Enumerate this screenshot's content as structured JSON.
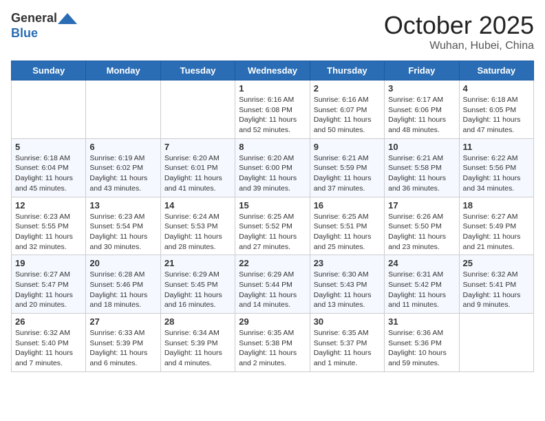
{
  "header": {
    "logo_line1": "General",
    "logo_line2": "Blue",
    "month": "October 2025",
    "location": "Wuhan, Hubei, China"
  },
  "weekdays": [
    "Sunday",
    "Monday",
    "Tuesday",
    "Wednesday",
    "Thursday",
    "Friday",
    "Saturday"
  ],
  "weeks": [
    [
      {
        "day": "",
        "info": ""
      },
      {
        "day": "",
        "info": ""
      },
      {
        "day": "",
        "info": ""
      },
      {
        "day": "1",
        "info": "Sunrise: 6:16 AM\nSunset: 6:08 PM\nDaylight: 11 hours\nand 52 minutes."
      },
      {
        "day": "2",
        "info": "Sunrise: 6:16 AM\nSunset: 6:07 PM\nDaylight: 11 hours\nand 50 minutes."
      },
      {
        "day": "3",
        "info": "Sunrise: 6:17 AM\nSunset: 6:06 PM\nDaylight: 11 hours\nand 48 minutes."
      },
      {
        "day": "4",
        "info": "Sunrise: 6:18 AM\nSunset: 6:05 PM\nDaylight: 11 hours\nand 47 minutes."
      }
    ],
    [
      {
        "day": "5",
        "info": "Sunrise: 6:18 AM\nSunset: 6:04 PM\nDaylight: 11 hours\nand 45 minutes."
      },
      {
        "day": "6",
        "info": "Sunrise: 6:19 AM\nSunset: 6:02 PM\nDaylight: 11 hours\nand 43 minutes."
      },
      {
        "day": "7",
        "info": "Sunrise: 6:20 AM\nSunset: 6:01 PM\nDaylight: 11 hours\nand 41 minutes."
      },
      {
        "day": "8",
        "info": "Sunrise: 6:20 AM\nSunset: 6:00 PM\nDaylight: 11 hours\nand 39 minutes."
      },
      {
        "day": "9",
        "info": "Sunrise: 6:21 AM\nSunset: 5:59 PM\nDaylight: 11 hours\nand 37 minutes."
      },
      {
        "day": "10",
        "info": "Sunrise: 6:21 AM\nSunset: 5:58 PM\nDaylight: 11 hours\nand 36 minutes."
      },
      {
        "day": "11",
        "info": "Sunrise: 6:22 AM\nSunset: 5:56 PM\nDaylight: 11 hours\nand 34 minutes."
      }
    ],
    [
      {
        "day": "12",
        "info": "Sunrise: 6:23 AM\nSunset: 5:55 PM\nDaylight: 11 hours\nand 32 minutes."
      },
      {
        "day": "13",
        "info": "Sunrise: 6:23 AM\nSunset: 5:54 PM\nDaylight: 11 hours\nand 30 minutes."
      },
      {
        "day": "14",
        "info": "Sunrise: 6:24 AM\nSunset: 5:53 PM\nDaylight: 11 hours\nand 28 minutes."
      },
      {
        "day": "15",
        "info": "Sunrise: 6:25 AM\nSunset: 5:52 PM\nDaylight: 11 hours\nand 27 minutes."
      },
      {
        "day": "16",
        "info": "Sunrise: 6:25 AM\nSunset: 5:51 PM\nDaylight: 11 hours\nand 25 minutes."
      },
      {
        "day": "17",
        "info": "Sunrise: 6:26 AM\nSunset: 5:50 PM\nDaylight: 11 hours\nand 23 minutes."
      },
      {
        "day": "18",
        "info": "Sunrise: 6:27 AM\nSunset: 5:49 PM\nDaylight: 11 hours\nand 21 minutes."
      }
    ],
    [
      {
        "day": "19",
        "info": "Sunrise: 6:27 AM\nSunset: 5:47 PM\nDaylight: 11 hours\nand 20 minutes."
      },
      {
        "day": "20",
        "info": "Sunrise: 6:28 AM\nSunset: 5:46 PM\nDaylight: 11 hours\nand 18 minutes."
      },
      {
        "day": "21",
        "info": "Sunrise: 6:29 AM\nSunset: 5:45 PM\nDaylight: 11 hours\nand 16 minutes."
      },
      {
        "day": "22",
        "info": "Sunrise: 6:29 AM\nSunset: 5:44 PM\nDaylight: 11 hours\nand 14 minutes."
      },
      {
        "day": "23",
        "info": "Sunrise: 6:30 AM\nSunset: 5:43 PM\nDaylight: 11 hours\nand 13 minutes."
      },
      {
        "day": "24",
        "info": "Sunrise: 6:31 AM\nSunset: 5:42 PM\nDaylight: 11 hours\nand 11 minutes."
      },
      {
        "day": "25",
        "info": "Sunrise: 6:32 AM\nSunset: 5:41 PM\nDaylight: 11 hours\nand 9 minutes."
      }
    ],
    [
      {
        "day": "26",
        "info": "Sunrise: 6:32 AM\nSunset: 5:40 PM\nDaylight: 11 hours\nand 7 minutes."
      },
      {
        "day": "27",
        "info": "Sunrise: 6:33 AM\nSunset: 5:39 PM\nDaylight: 11 hours\nand 6 minutes."
      },
      {
        "day": "28",
        "info": "Sunrise: 6:34 AM\nSunset: 5:39 PM\nDaylight: 11 hours\nand 4 minutes."
      },
      {
        "day": "29",
        "info": "Sunrise: 6:35 AM\nSunset: 5:38 PM\nDaylight: 11 hours\nand 2 minutes."
      },
      {
        "day": "30",
        "info": "Sunrise: 6:35 AM\nSunset: 5:37 PM\nDaylight: 11 hours\nand 1 minute."
      },
      {
        "day": "31",
        "info": "Sunrise: 6:36 AM\nSunset: 5:36 PM\nDaylight: 10 hours\nand 59 minutes."
      },
      {
        "day": "",
        "info": ""
      }
    ]
  ]
}
